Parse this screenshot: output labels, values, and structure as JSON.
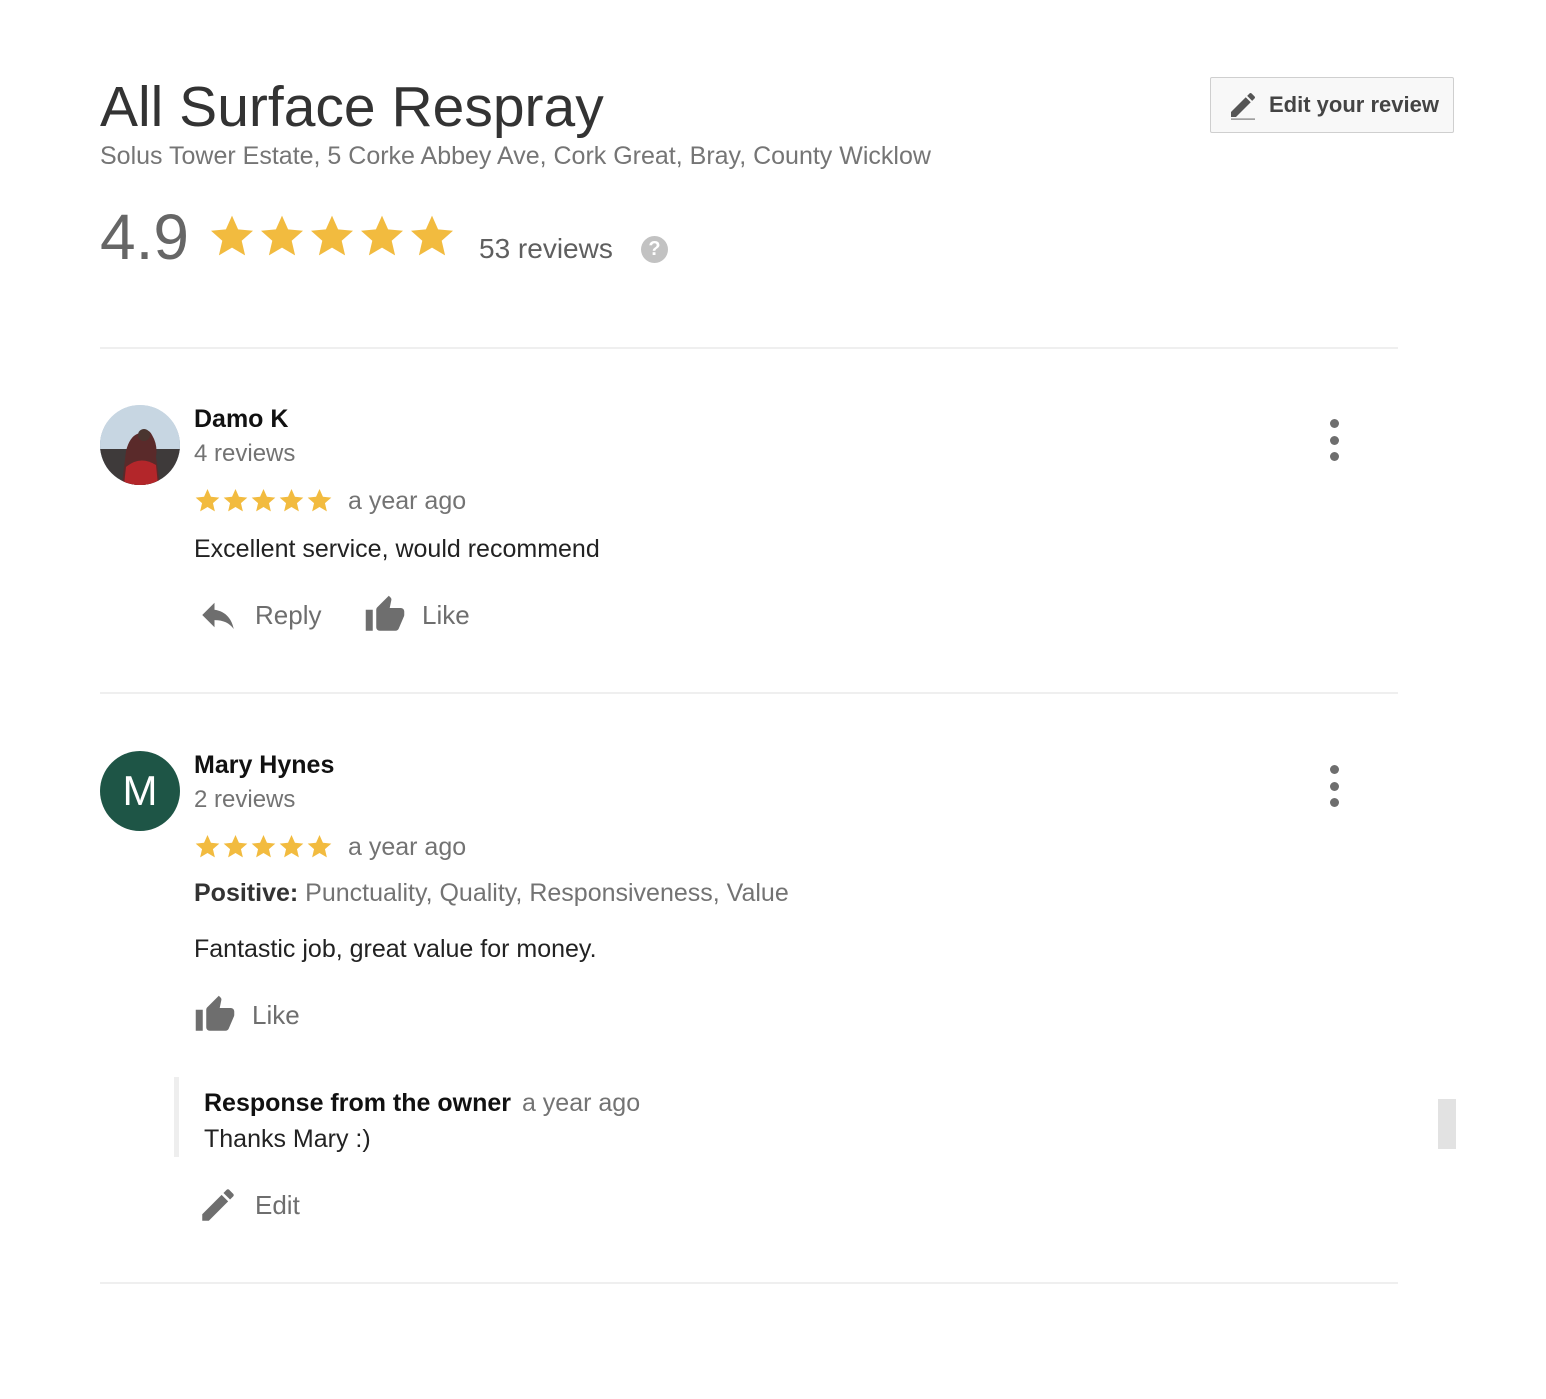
{
  "business": {
    "name": "All Surface Respray",
    "address": "Solus Tower Estate, 5 Corke Abbey Ave, Cork Great, Bray, County Wicklow",
    "rating": "4.9",
    "rating_stars": 5,
    "review_count": "53 reviews",
    "help_symbol": "?"
  },
  "header": {
    "edit_review_label": "Edit your review",
    "edit_icon": "pencil-icon"
  },
  "colors": {
    "star": "#f2bb3f",
    "avatar_green": "#1e5546",
    "muted_text": "#737373"
  },
  "reviews": [
    {
      "author": "Damo K",
      "author_reviews": "4 reviews",
      "stars": 5,
      "time": "a year ago",
      "text": "Excellent service, would recommend",
      "actions": {
        "reply": "Reply",
        "like": "Like"
      }
    },
    {
      "author": "Mary Hynes",
      "avatar_letter": "M",
      "author_reviews": "2 reviews",
      "stars": 5,
      "time": "a year ago",
      "positive_label": "Positive:",
      "positive_values": "Punctuality, Quality, Responsiveness, Value",
      "text": "Fantastic job, great value for money.",
      "actions": {
        "like": "Like",
        "edit": "Edit"
      },
      "owner_response": {
        "title": "Response from the owner",
        "time": "a year ago",
        "text": "Thanks Mary :)"
      }
    }
  ]
}
